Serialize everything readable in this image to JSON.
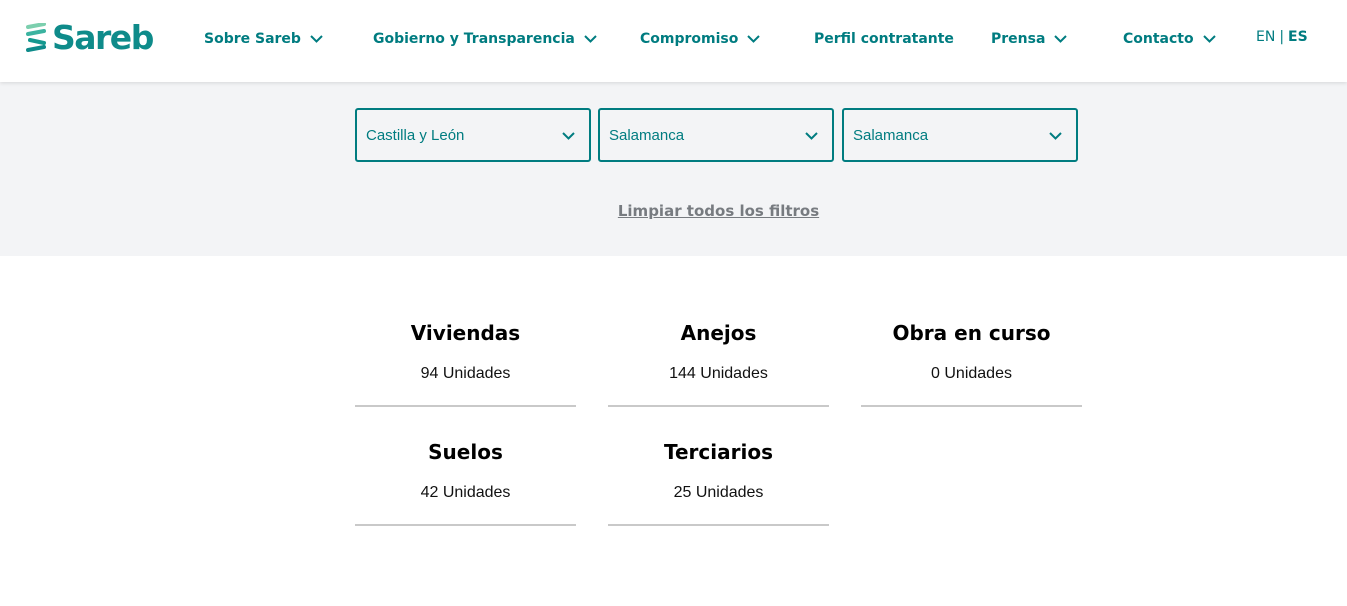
{
  "brand": {
    "name": "Sareb",
    "color": "#0e8b8a"
  },
  "nav": {
    "items": [
      {
        "label": "Sobre Sareb",
        "icon": "chevron-down-icon"
      },
      {
        "label": "Gobierno y Transparencia",
        "icon": "chevron-down-icon"
      },
      {
        "label": "Compromiso",
        "icon": "chevron-down-icon"
      },
      {
        "label": "Perfil contratante"
      },
      {
        "label": "Prensa",
        "icon": "chevron-down-icon"
      },
      {
        "label": "Contacto",
        "icon": "chevron-down-icon"
      }
    ],
    "lang_en": "EN",
    "lang_sep": "|",
    "lang_es": "ES"
  },
  "filters": {
    "selects": [
      {
        "value": "Castilla y León",
        "icon": "chevron-down-icon"
      },
      {
        "value": "Salamanca",
        "icon": "chevron-down-icon"
      },
      {
        "value": "Salamanca",
        "icon": "chevron-down-icon"
      }
    ],
    "clear_label": "Limpiar todos los filtros"
  },
  "stats": [
    {
      "title": "Viviendas",
      "units": "94 Unidades"
    },
    {
      "title": "Anejos",
      "units": "144 Unidades"
    },
    {
      "title": "Obra en curso",
      "units": "0 Unidades"
    },
    {
      "title": "Suelos",
      "units": "42 Unidades"
    },
    {
      "title": "Terciarios",
      "units": "25 Unidades"
    }
  ],
  "colors": {
    "accent": "#007c80",
    "band_background": "#f3f4f6",
    "divider": "#c9c9c9",
    "muted_link": "#777b80"
  }
}
